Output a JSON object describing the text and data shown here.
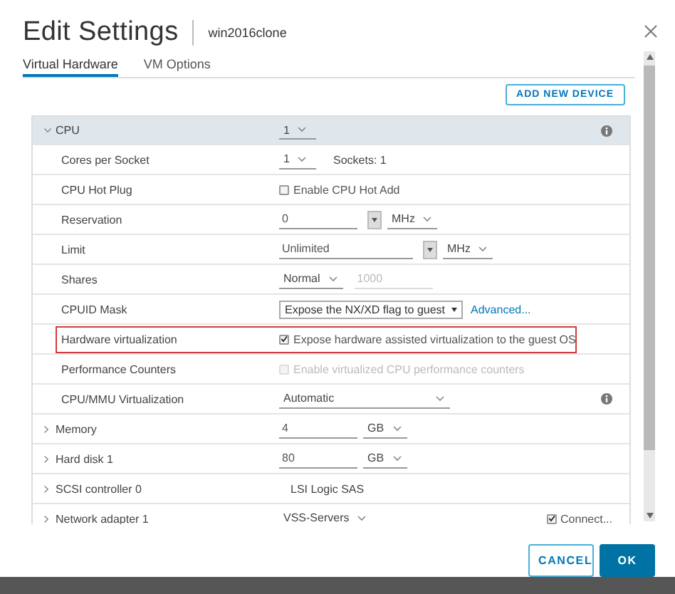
{
  "window": {
    "title": "Edit Settings",
    "subtitle": "win2016clone"
  },
  "tabs": [
    {
      "label": "Virtual Hardware",
      "selected": true
    },
    {
      "label": "VM Options",
      "selected": false
    }
  ],
  "toolbar": {
    "button": "ADD NEW DEVICE"
  },
  "rows": [
    {
      "kind": "group",
      "label": "CPU",
      "expanded": true,
      "highlighted": false,
      "info": true,
      "controls": [
        {
          "kind": "select",
          "value": "1"
        }
      ],
      "end": []
    },
    {
      "kind": "item",
      "label": "Cores per Socket",
      "highlighted": false,
      "info": false,
      "controls": [
        {
          "kind": "select",
          "value": "1"
        },
        {
          "kind": "text",
          "value": "Sockets: 1"
        }
      ],
      "end": []
    },
    {
      "kind": "item",
      "label": "CPU Hot Plug",
      "highlighted": false,
      "info": false,
      "controls": [
        {
          "kind": "checkbox",
          "label": "Enable CPU Hot Add",
          "checked": false,
          "disabled": false
        }
      ],
      "end": []
    },
    {
      "kind": "item",
      "label": "Reservation",
      "highlighted": false,
      "info": false,
      "controls": [
        {
          "kind": "field",
          "value": "0",
          "disabled": false
        },
        {
          "kind": "spin"
        },
        {
          "kind": "select",
          "value": "MHz"
        }
      ],
      "end": []
    },
    {
      "kind": "item",
      "label": "Limit",
      "highlighted": false,
      "info": false,
      "controls": [
        {
          "kind": "wide-field",
          "value": "Unlimited",
          "disabled": false
        },
        {
          "kind": "spin"
        },
        {
          "kind": "select",
          "value": "MHz"
        }
      ],
      "end": []
    },
    {
      "kind": "item",
      "label": "Shares",
      "highlighted": false,
      "info": false,
      "controls": [
        {
          "kind": "select",
          "value": "Normal"
        },
        {
          "kind": "field",
          "value": "1000",
          "disabled": true
        }
      ],
      "end": []
    },
    {
      "kind": "item",
      "label": "CPUID Mask",
      "highlighted": false,
      "info": false,
      "controls": [
        {
          "kind": "dropdown",
          "value": "Expose the NX/XD flag to guest"
        },
        {
          "kind": "link",
          "value": "Advanced..."
        }
      ],
      "end": []
    },
    {
      "kind": "item",
      "label": "Hardware virtualization",
      "highlighted": true,
      "info": false,
      "controls": [
        {
          "kind": "checkbox",
          "label": "Expose hardware assisted virtualization to the guest OS",
          "checked": true,
          "disabled": false
        }
      ],
      "end": []
    },
    {
      "kind": "item",
      "label": "Performance Counters",
      "highlighted": false,
      "info": false,
      "controls": [
        {
          "kind": "checkbox",
          "label": "Enable virtualized CPU performance counters",
          "checked": false,
          "disabled": true
        }
      ],
      "end": []
    },
    {
      "kind": "item",
      "label": "CPU/MMU Virtualization",
      "highlighted": false,
      "info": true,
      "controls": [
        {
          "kind": "wide-select",
          "value": "Automatic"
        }
      ],
      "end": []
    },
    {
      "kind": "group",
      "label": "Memory",
      "expanded": false,
      "highlighted": false,
      "info": false,
      "controls": [
        {
          "kind": "field",
          "value": "4",
          "disabled": false
        },
        {
          "kind": "select",
          "value": "GB"
        }
      ],
      "end": []
    },
    {
      "kind": "group",
      "label": "Hard disk 1",
      "expanded": false,
      "highlighted": false,
      "info": false,
      "controls": [
        {
          "kind": "field",
          "value": "80",
          "disabled": false
        },
        {
          "kind": "select",
          "value": "GB"
        }
      ],
      "end": []
    },
    {
      "kind": "group",
      "label": "SCSI controller 0",
      "expanded": false,
      "highlighted": false,
      "info": false,
      "controls": [
        {
          "kind": "text",
          "value": "LSI Logic SAS"
        }
      ],
      "end": []
    },
    {
      "kind": "group",
      "label": "Network adapter 1",
      "expanded": false,
      "highlighted": false,
      "info": false,
      "controls": [
        {
          "kind": "select",
          "value": "VSS-Servers"
        }
      ],
      "end": [
        {
          "kind": "checkbox",
          "label": "Connect...",
          "checked": true,
          "disabled": false
        }
      ]
    }
  ],
  "buttons": [
    {
      "label": "CANCEL",
      "kind": "secondary"
    },
    {
      "label": "OK",
      "kind": "primary"
    }
  ]
}
